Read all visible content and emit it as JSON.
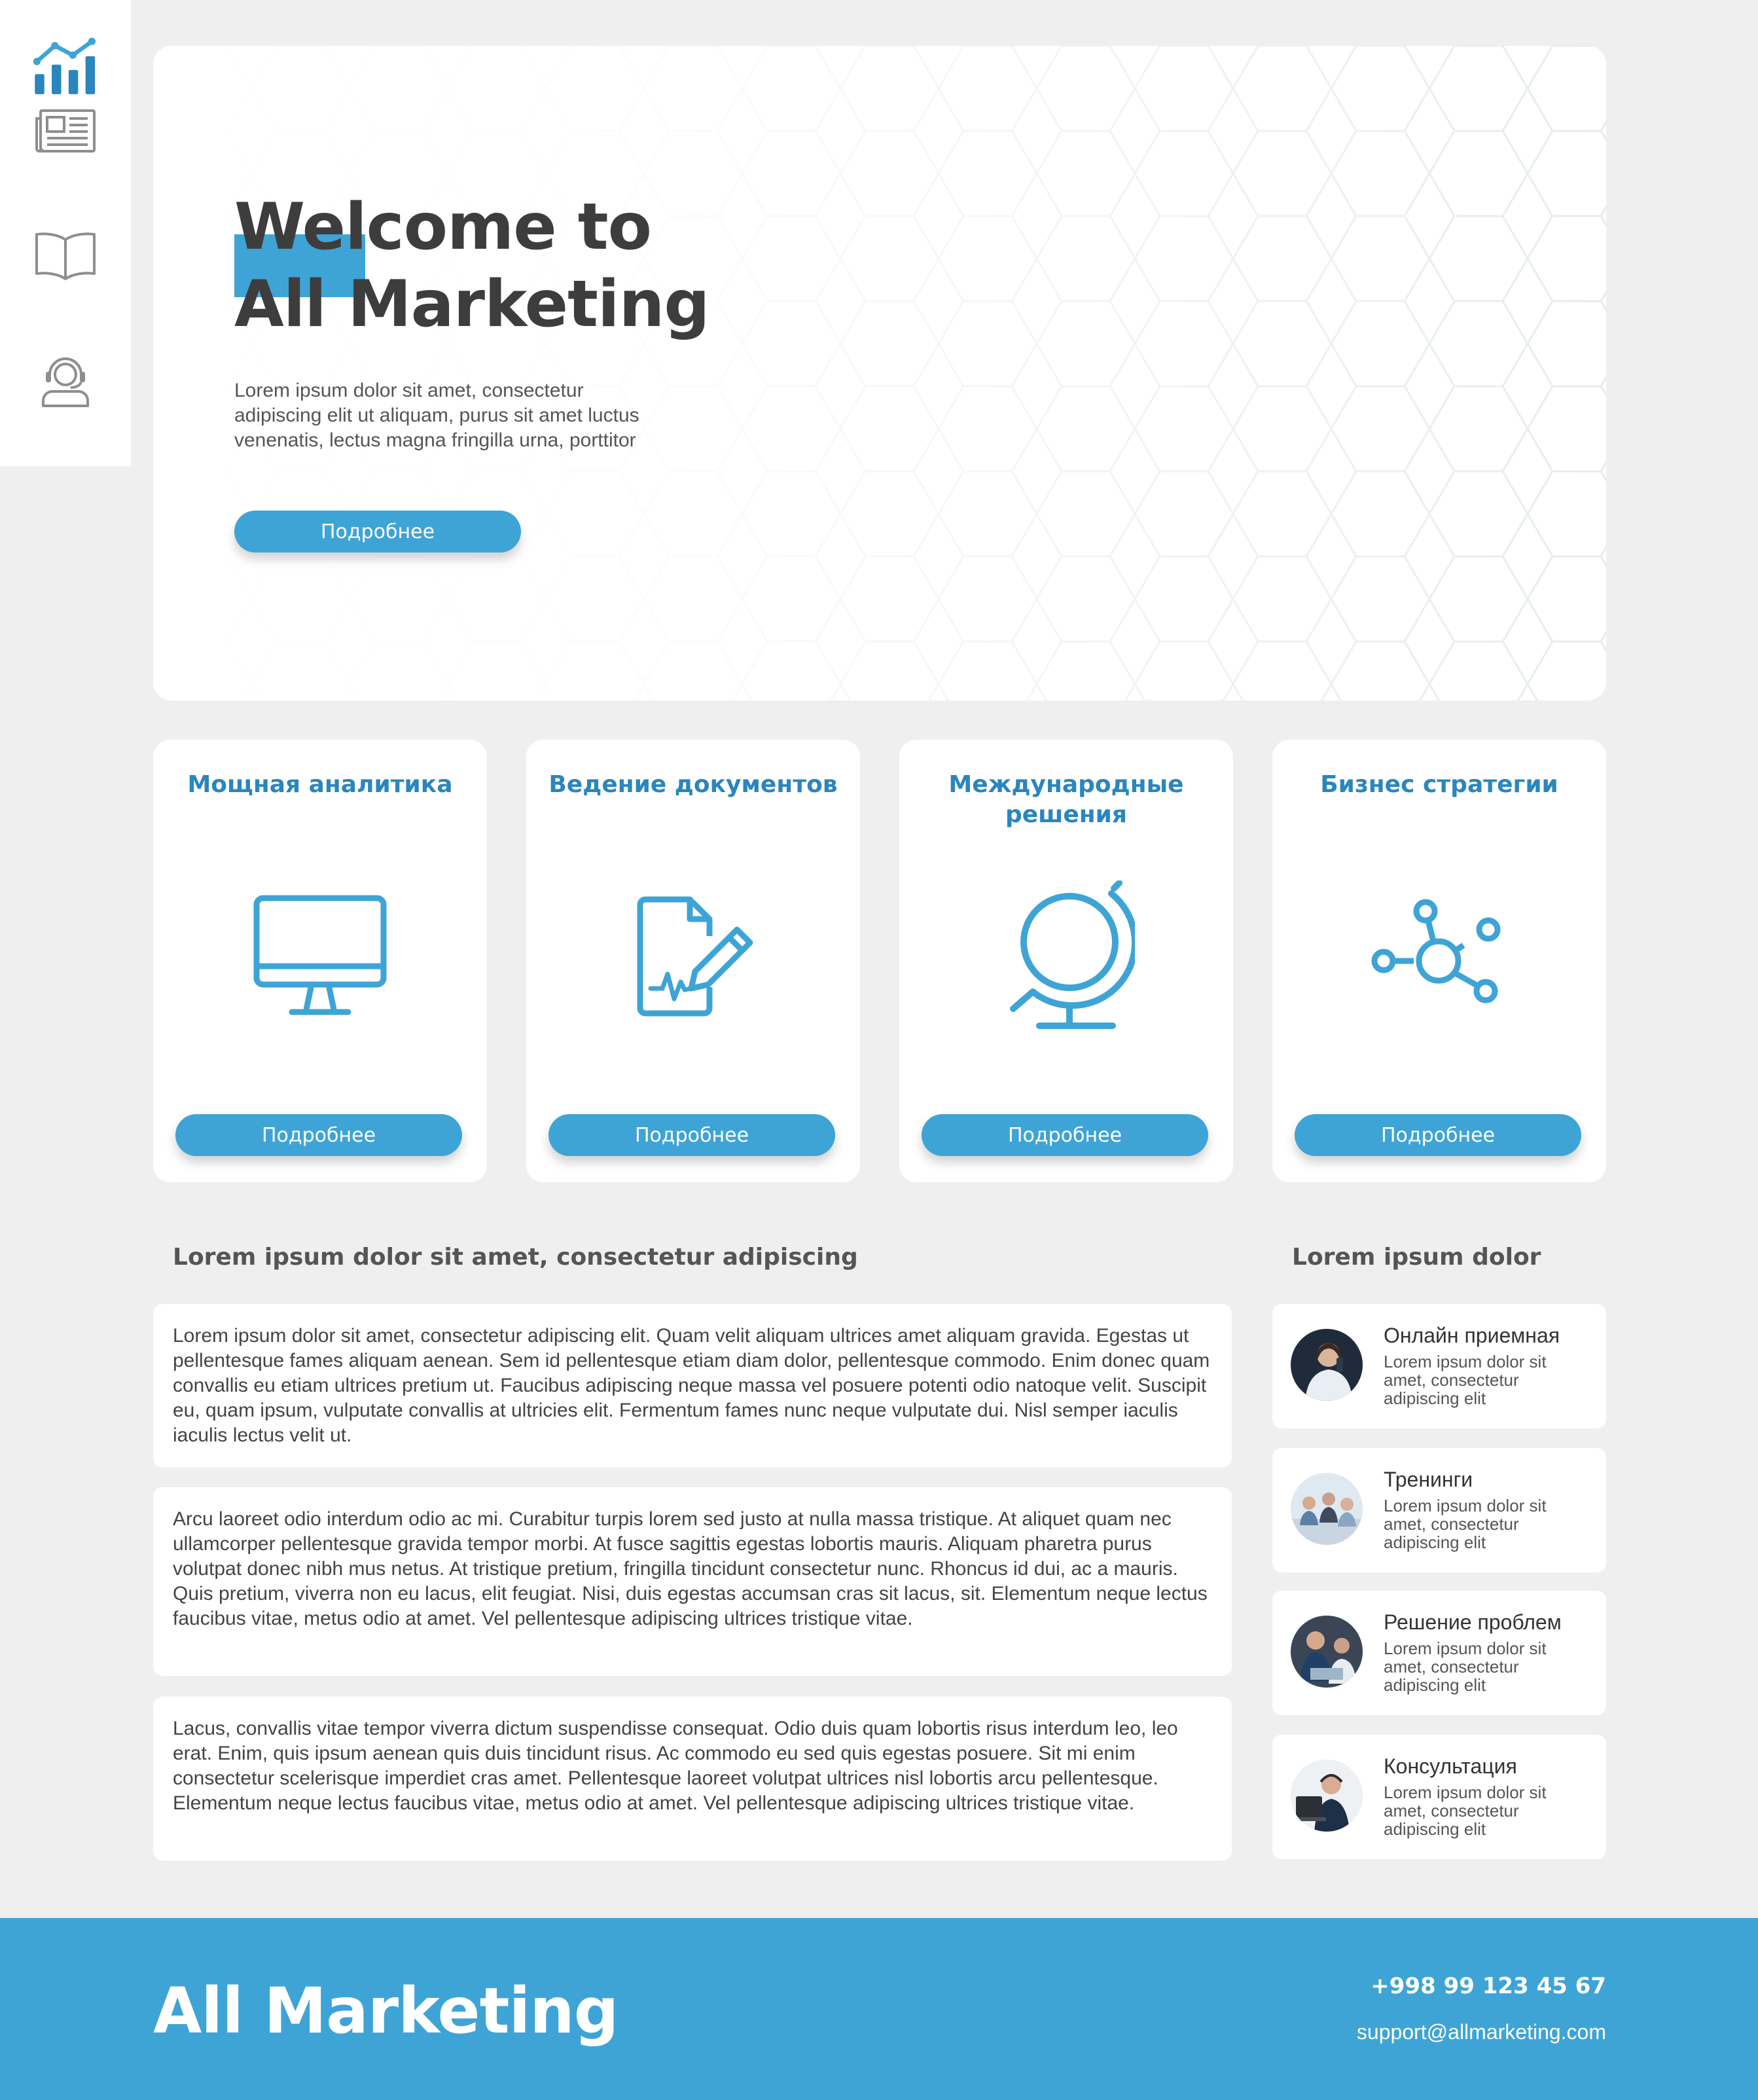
{
  "colors": {
    "accent": "#3ea4d6",
    "card_title": "#2a86bd",
    "background": "#efefef"
  },
  "sidebar": {
    "items": [
      {
        "name": "analytics",
        "icon": "bar-chart-icon"
      },
      {
        "name": "news",
        "icon": "newspaper-icon"
      },
      {
        "name": "docs",
        "icon": "book-icon"
      },
      {
        "name": "support",
        "icon": "headset-user-icon"
      }
    ]
  },
  "hero": {
    "title_line1": "Welcome to",
    "title_line2": "All Marketing",
    "text": "Lorem ipsum dolor sit amet, consectetur adipiscing elit ut aliquam, purus sit amet luctus venenatis, lectus magna fringilla urna, porttitor",
    "button": "Подробнее"
  },
  "features": [
    {
      "title": "Мощная аналитика",
      "icon": "monitor-icon",
      "button": "Подробнее"
    },
    {
      "title": "Ведение документов",
      "icon": "document-sign-icon",
      "button": "Подробнее"
    },
    {
      "title": "Международные решения",
      "icon": "globe-icon",
      "button": "Подробнее"
    },
    {
      "title": "Бизнес стратегии",
      "icon": "network-icon",
      "button": "Подробнее"
    }
  ],
  "main": {
    "title": "Lorem ipsum dolor sit amet, consectetur adipiscing",
    "paragraphs": [
      "Lorem ipsum dolor sit amet, consectetur adipiscing elit. Quam velit aliquam ultrices amet aliquam gravida. Egestas ut pellentesque fames aliquam aenean. Sem id pellentesque etiam diam dolor, pellentesque commodo. Enim donec quam convallis eu etiam ultrices pretium ut. Faucibus adipiscing neque massa vel posuere potenti odio natoque velit. Suscipit eu, quam ipsum, vulputate convallis at ultricies elit. Fermentum fames nunc neque vulputate dui. Nisl semper iaculis iaculis lectus velit ut.",
      "Arcu laoreet odio interdum odio ac mi. Curabitur turpis lorem sed justo at nulla massa tristique. At aliquet quam nec ullamcorper pellentesque gravida tempor morbi. At fusce sagittis egestas lobortis mauris. Aliquam pharetra purus volutpat donec nibh mus netus. At tristique pretium, fringilla tincidunt consectetur nunc. Rhoncus id dui, ac a mauris. Quis pretium, viverra non eu lacus, elit feugiat. Nisi, duis egestas accumsan cras sit lacus, sit. Elementum neque lectus faucibus vitae, metus odio at amet. Vel pellentesque adipiscing ultrices tristique vitae.",
      "Lacus, convallis vitae tempor viverra dictum suspendisse consequat. Odio duis quam lobortis risus interdum leo, leo erat. Enim, quis ipsum aenean quis duis tincidunt risus. Ac commodo eu sed quis egestas posuere. Sit mi enim consectetur scelerisque imperdiet cras amet. Pellentesque laoreet volutpat ultrices nisl lobortis arcu pellentesque. Elementum neque lectus faucibus vitae, metus odio at amet. Vel pellentesque adipiscing ultrices tristique vitae."
    ]
  },
  "side": {
    "title": "Lorem ipsum dolor",
    "items": [
      {
        "title": "Онлайн приемная",
        "desc": "Lorem ipsum dolor sit amet, consectetur adipiscing elit"
      },
      {
        "title": "Тренинги",
        "desc": "Lorem ipsum dolor sit amet, consectetur adipiscing elit"
      },
      {
        "title": "Решение проблем",
        "desc": "Lorem ipsum dolor sit amet, consectetur adipiscing elit"
      },
      {
        "title": "Консультация",
        "desc": "Lorem ipsum dolor sit amet, consectetur adipiscing elit"
      }
    ]
  },
  "footer": {
    "brand": "All Marketing",
    "phone": "+998 99 123 45 67",
    "email": "support@allmarketing.com"
  }
}
